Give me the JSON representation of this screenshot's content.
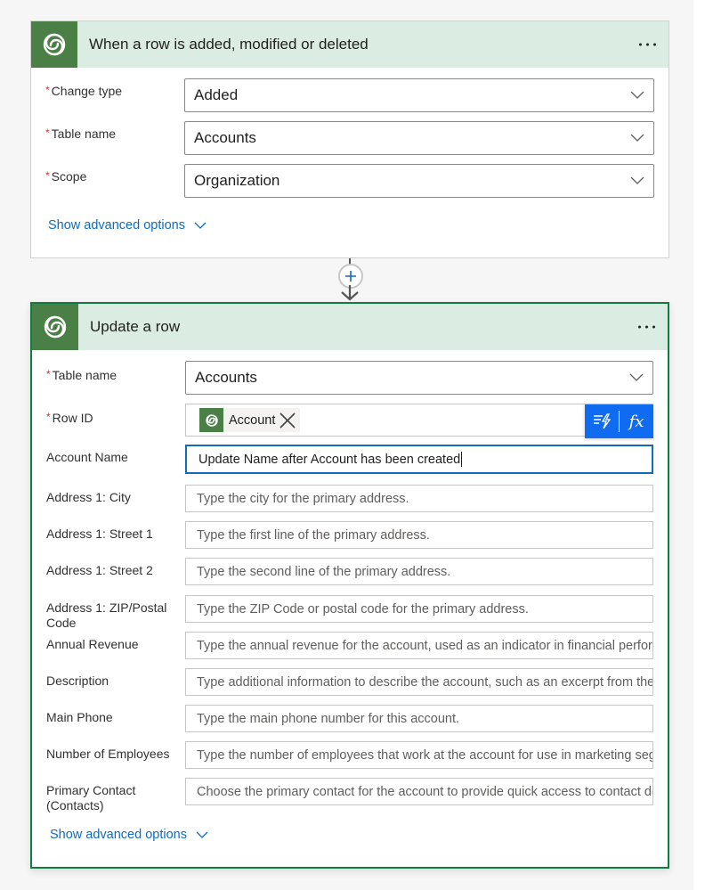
{
  "trigger_card": {
    "title": "When a row is added, modified or deleted",
    "more_label": "More options",
    "fields": [
      {
        "label": "Change type",
        "required": "*",
        "value": "Added"
      },
      {
        "label": "Table name",
        "required": "*",
        "value": "Accounts"
      },
      {
        "label": "Scope",
        "required": "*",
        "value": "Organization"
      }
    ],
    "advanced_label": "Show advanced options"
  },
  "connector": {
    "add_label": "+"
  },
  "action_card": {
    "title": "Update a row",
    "more_label": "More options",
    "table_name": {
      "label": "Table name",
      "required": "*",
      "value": "Accounts"
    },
    "row_id": {
      "label": "Row ID",
      "required": "*",
      "token": "Account"
    },
    "dynamic_panel": {
      "dynamic_content_icon": "lightning-list-icon",
      "expression_label": "fx"
    },
    "account_name": {
      "label": "Account Name",
      "value": "Update Name after Account has been created"
    },
    "fields": [
      {
        "label": "Address 1: City",
        "placeholder": "Type the city for the primary address."
      },
      {
        "label": "Address 1: Street 1",
        "placeholder": "Type the first line of the primary address."
      },
      {
        "label": "Address 1: Street 2",
        "placeholder": "Type the second line of the primary address."
      },
      {
        "label": "Address 1: ZIP/Postal Code",
        "placeholder": "Type the ZIP Code or postal code for the primary address."
      },
      {
        "label": "Annual Revenue",
        "placeholder": "Type the annual revenue for the account, used as an indicator in financial performance analysis."
      },
      {
        "label": "Description",
        "placeholder": "Type additional information to describe the account, such as an excerpt from the company's website."
      },
      {
        "label": "Main Phone",
        "placeholder": "Type the main phone number for this account."
      },
      {
        "label": "Number of Employees",
        "placeholder": "Type the number of employees that work at the account for use in marketing segmentation and demographic analysis."
      },
      {
        "label": "Primary Contact (Contacts)",
        "placeholder": "Choose the primary contact for the account to provide quick access to contact details."
      }
    ],
    "advanced_label": "Show advanced options"
  },
  "colors": {
    "brand_green": "#4a7f46",
    "header_bg": "#dbece3",
    "selected_border": "#107c41",
    "link_blue": "#0f6cbd",
    "required_red": "#d13438",
    "dynamic_panel_blue": "#0f6cf0"
  }
}
